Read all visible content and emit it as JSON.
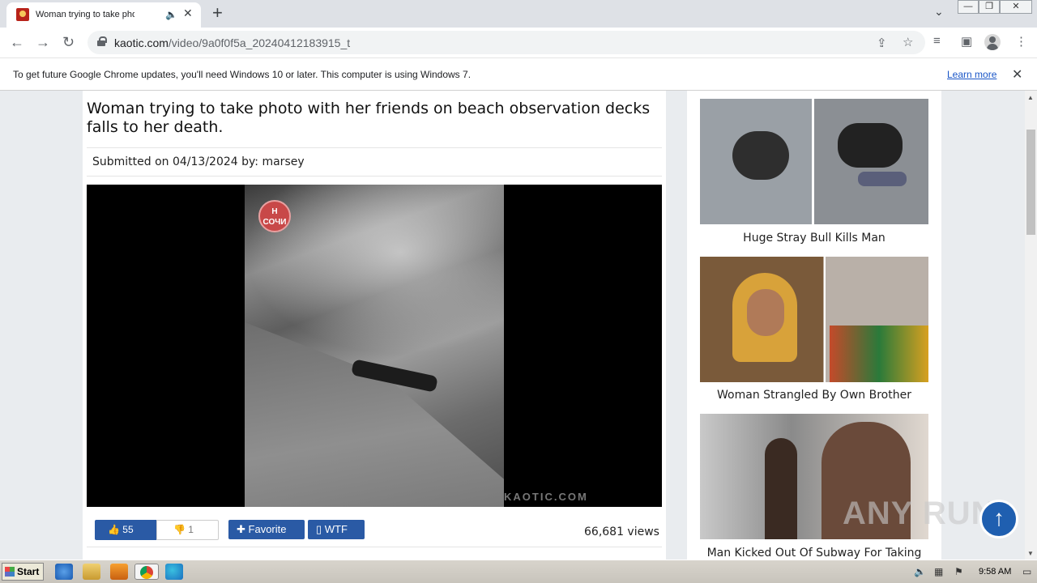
{
  "browser": {
    "tab_title": "Woman trying to take photo with",
    "url_domain": "kaotic.com",
    "url_path": "/video/9a0f0f5a_20240412183915_t"
  },
  "infobar": {
    "message": "To get future Google Chrome updates, you'll need Windows 10 or later. This computer is using Windows 7.",
    "learn_more": "Learn more"
  },
  "article": {
    "title": "Woman trying to take photo with her friends on beach observation decks falls to her death.",
    "submitted": "Submitted on 04/13/2024 by:",
    "author": "marsey",
    "video_badge": "СОЧИ",
    "video_watermark": "KAOTIC.COM",
    "likes": "55",
    "dislikes": "1",
    "favorite_label": "Favorite",
    "wtf_label": "WTF",
    "views": "66,681 views"
  },
  "sidebar": {
    "items": [
      {
        "caption": "Huge Stray Bull Kills Man"
      },
      {
        "caption": "Woman Strangled By Own Brother"
      },
      {
        "caption": "Man Kicked Out Of Subway For Taking"
      }
    ]
  },
  "overlay": {
    "watermark": "ANY RUN"
  },
  "taskbar": {
    "start": "Start",
    "clock": "9:58 AM"
  }
}
